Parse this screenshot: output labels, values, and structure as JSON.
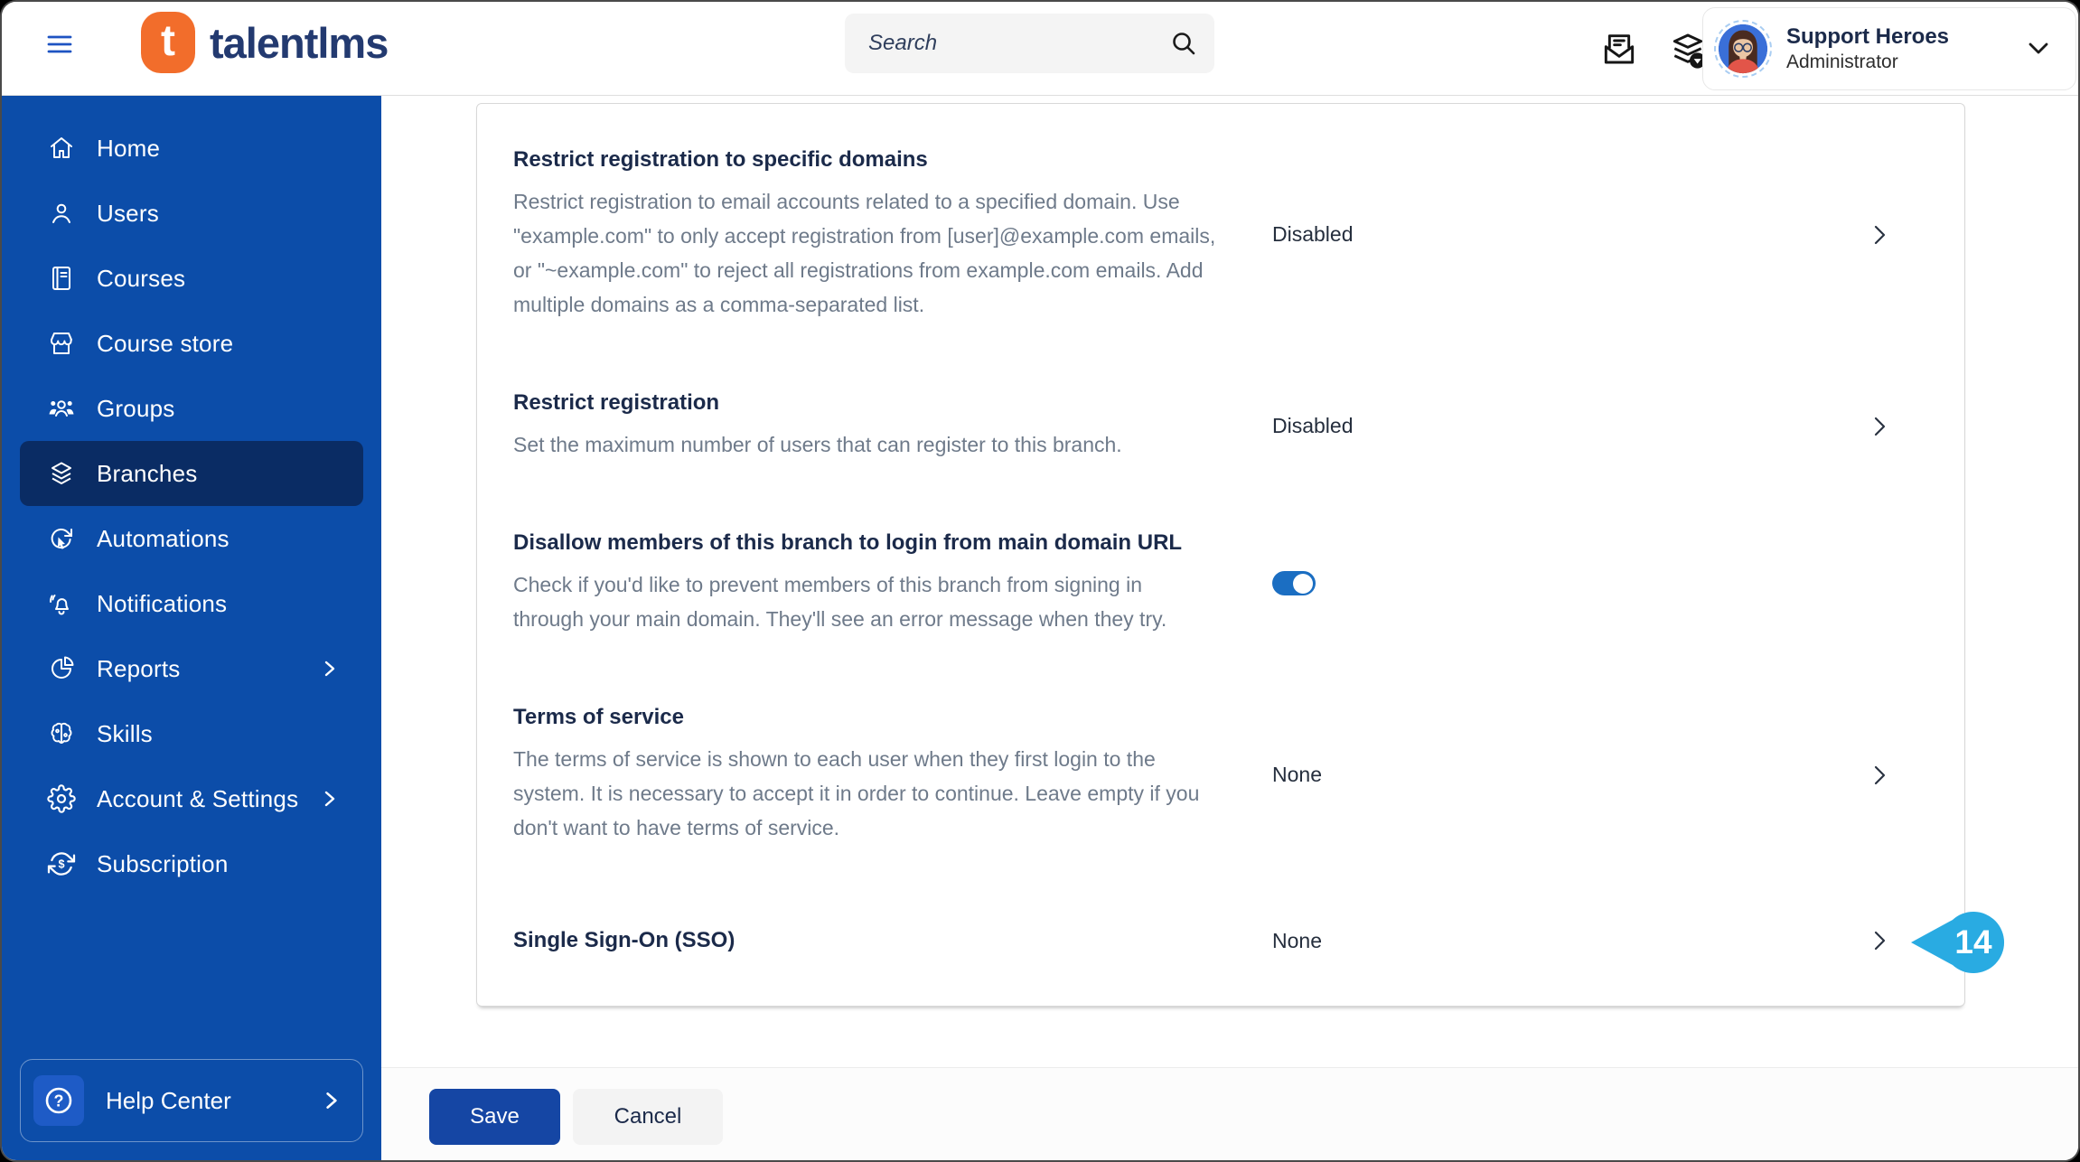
{
  "header": {
    "logo": {
      "letter": "t",
      "wordmark": "talentlms"
    },
    "search": {
      "placeholder": "Search"
    },
    "user": {
      "name": "Support Heroes",
      "role": "Administrator"
    },
    "icons": {
      "menu": "hamburger-icon",
      "search": "search-icon",
      "messages": "message-inbox-icon",
      "branch_switcher": "layers-switch-icon",
      "user_chevron": "chevron-down-icon"
    }
  },
  "sidebar": {
    "items": [
      {
        "label": "Home",
        "icon": "home-icon",
        "selected": false
      },
      {
        "label": "Users",
        "icon": "user-icon",
        "selected": false
      },
      {
        "label": "Courses",
        "icon": "book-icon",
        "selected": false
      },
      {
        "label": "Course store",
        "icon": "storefront-icon",
        "selected": false
      },
      {
        "label": "Groups",
        "icon": "group-icon",
        "selected": false
      },
      {
        "label": "Branches",
        "icon": "layers-icon",
        "selected": true
      },
      {
        "label": "Automations",
        "icon": "automation-icon",
        "selected": false
      },
      {
        "label": "Notifications",
        "icon": "bell-icon",
        "selected": false
      },
      {
        "label": "Reports",
        "icon": "pie-chart-icon",
        "selected": false,
        "has_submenu": true
      },
      {
        "label": "Skills",
        "icon": "brain-icon",
        "selected": false
      },
      {
        "label": "Account & Settings",
        "icon": "gear-icon",
        "selected": false,
        "has_submenu": true
      },
      {
        "label": "Subscription",
        "icon": "renewal-icon",
        "selected": false
      }
    ],
    "help": {
      "label": "Help Center",
      "icon": "question-circle-icon"
    }
  },
  "settings": {
    "toggle_on": true,
    "rows": [
      {
        "title": "Restrict registration to specific domains",
        "description": "Restrict registration to email accounts related to a specified domain. Use \"example.com\" to only accept registration from [user]@example.com emails, or \"~example.com\" to reject all registrations from example.com emails. Add multiple domains as a comma-separated list.",
        "value": "Disabled"
      },
      {
        "title": "Restrict registration",
        "description": "Set the maximum number of users that can register to this branch.",
        "value": "Disabled"
      },
      {
        "title": "Disallow members of this branch to login from main domain URL",
        "description": "Check if you'd like to prevent members of this branch from signing in through your main domain. They'll see an error message when they try.",
        "control": "toggle",
        "value": "On"
      },
      {
        "title": "Terms of service",
        "description": "The terms of service is shown to each user when they first login to the system. It is necessary to accept it in order to continue. Leave empty if you don't want to have terms of service.",
        "value": "None"
      },
      {
        "title": "Single Sign-On (SSO)",
        "value": "None",
        "badge": "14"
      }
    ]
  },
  "footer": {
    "save_label": "Save",
    "cancel_label": "Cancel"
  },
  "colors": {
    "sidebar": "#0C4DA9",
    "sidebar_selected": "#0A2C64",
    "accent_orange": "#F26D2B",
    "toggle_on": "#1B6EC2",
    "badge_blue": "#29ABE2",
    "save_button": "#1546A4"
  }
}
